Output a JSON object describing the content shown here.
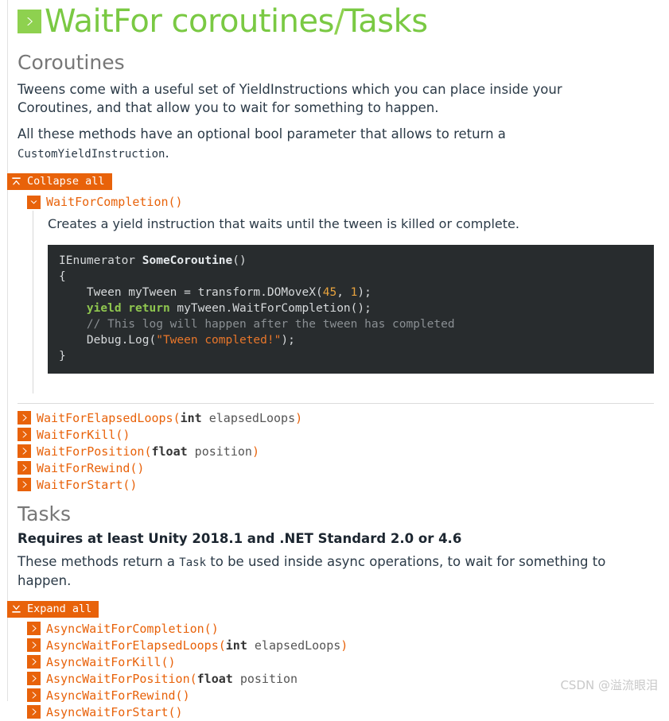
{
  "page": {
    "title": "WaitFor coroutines/Tasks",
    "title_main": "WaitFor coroutines",
    "title_slash": "/",
    "title_sub": "Tasks",
    "title_icon": "chevron-right-icon",
    "accent_green": "#7ac943",
    "accent_orange": "#e8620a",
    "code_bg": "#282c2e"
  },
  "coroutines": {
    "heading": "Coroutines",
    "paragraph_1": "Tweens come with a useful set of YieldInstructions which you can place inside your Coroutines, and that allow you to wait for something to happen.",
    "paragraph_2_pre": "All these methods have an optional bool parameter that allows to return a ",
    "paragraph_2_code": "CustomYieldInstruction",
    "paragraph_2_post": ".",
    "toggle_all": {
      "label": "Collapse all",
      "icon": "collapse-all-icon",
      "state": "expanded"
    },
    "expanded_method": {
      "signature": "WaitForCompletion()",
      "icon": "chevron-down-icon",
      "description": "Creates a yield instruction that waits until the tween is killed or complete.",
      "code_lines": [
        [
          {
            "t": "IEnumerator ",
            "c": "plain"
          },
          {
            "t": "SomeCoroutine",
            "c": "def"
          },
          {
            "t": "()",
            "c": "plain"
          }
        ],
        [
          {
            "t": "{",
            "c": "plain"
          }
        ],
        [
          {
            "t": "    Tween myTween = transform.DOMoveX(",
            "c": "plain"
          },
          {
            "t": "45",
            "c": "num"
          },
          {
            "t": ", ",
            "c": "plain"
          },
          {
            "t": "1",
            "c": "num"
          },
          {
            "t": ");",
            "c": "plain"
          }
        ],
        [
          {
            "t": "    ",
            "c": "plain"
          },
          {
            "t": "yield return",
            "c": "kw"
          },
          {
            "t": " myTween.WaitForCompletion();",
            "c": "plain"
          }
        ],
        [
          {
            "t": "    // This log will happen after the tween has completed",
            "c": "com"
          }
        ],
        [
          {
            "t": "    Debug.Log(",
            "c": "plain"
          },
          {
            "t": "\"Tween completed!\"",
            "c": "str"
          },
          {
            "t": ");",
            "c": "plain"
          }
        ],
        [
          {
            "t": "}",
            "c": "plain"
          }
        ]
      ]
    },
    "methods": [
      {
        "icon": "chevron-right-icon",
        "name": "WaitForElapsedLoops(",
        "ptype": "int",
        "pname": " elapsedLoops",
        "close": ")"
      },
      {
        "icon": "chevron-right-icon",
        "name": "WaitForKill()",
        "ptype": "",
        "pname": "",
        "close": ""
      },
      {
        "icon": "chevron-right-icon",
        "name": "WaitForPosition(",
        "ptype": "float",
        "pname": " position",
        "close": ")"
      },
      {
        "icon": "chevron-right-icon",
        "name": "WaitForRewind()",
        "ptype": "",
        "pname": "",
        "close": ""
      },
      {
        "icon": "chevron-right-icon",
        "name": "WaitForStart()",
        "ptype": "",
        "pname": "",
        "close": ""
      }
    ]
  },
  "tasks": {
    "heading": "Tasks",
    "requirement": "Requires at least Unity 2018.1 and .NET Standard 2.0 or 4.6",
    "paragraph_pre": "These methods return a ",
    "paragraph_code": "Task",
    "paragraph_post": " to be used inside async operations, to wait for something to happen.",
    "toggle_all": {
      "label": "Expand all",
      "icon": "expand-all-icon",
      "state": "collapsed"
    },
    "methods": [
      {
        "icon": "chevron-right-icon",
        "name": "AsyncWaitForCompletion()",
        "ptype": "",
        "pname": "",
        "close": ""
      },
      {
        "icon": "chevron-right-icon",
        "name": "AsyncWaitForElapsedLoops(",
        "ptype": "int",
        "pname": " elapsedLoops",
        "close": ")"
      },
      {
        "icon": "chevron-right-icon",
        "name": "AsyncWaitForKill()",
        "ptype": "",
        "pname": "",
        "close": ""
      },
      {
        "icon": "chevron-right-icon",
        "name": "AsyncWaitForPosition(",
        "ptype": "float",
        "pname": " position",
        "close": ""
      },
      {
        "icon": "chevron-right-icon",
        "name": "AsyncWaitForRewind()",
        "ptype": "",
        "pname": "",
        "close": ""
      },
      {
        "icon": "chevron-right-icon",
        "name": "AsyncWaitForStart()",
        "ptype": "",
        "pname": "",
        "close": ""
      }
    ]
  },
  "watermark": "CSDN @溢流眼泪"
}
